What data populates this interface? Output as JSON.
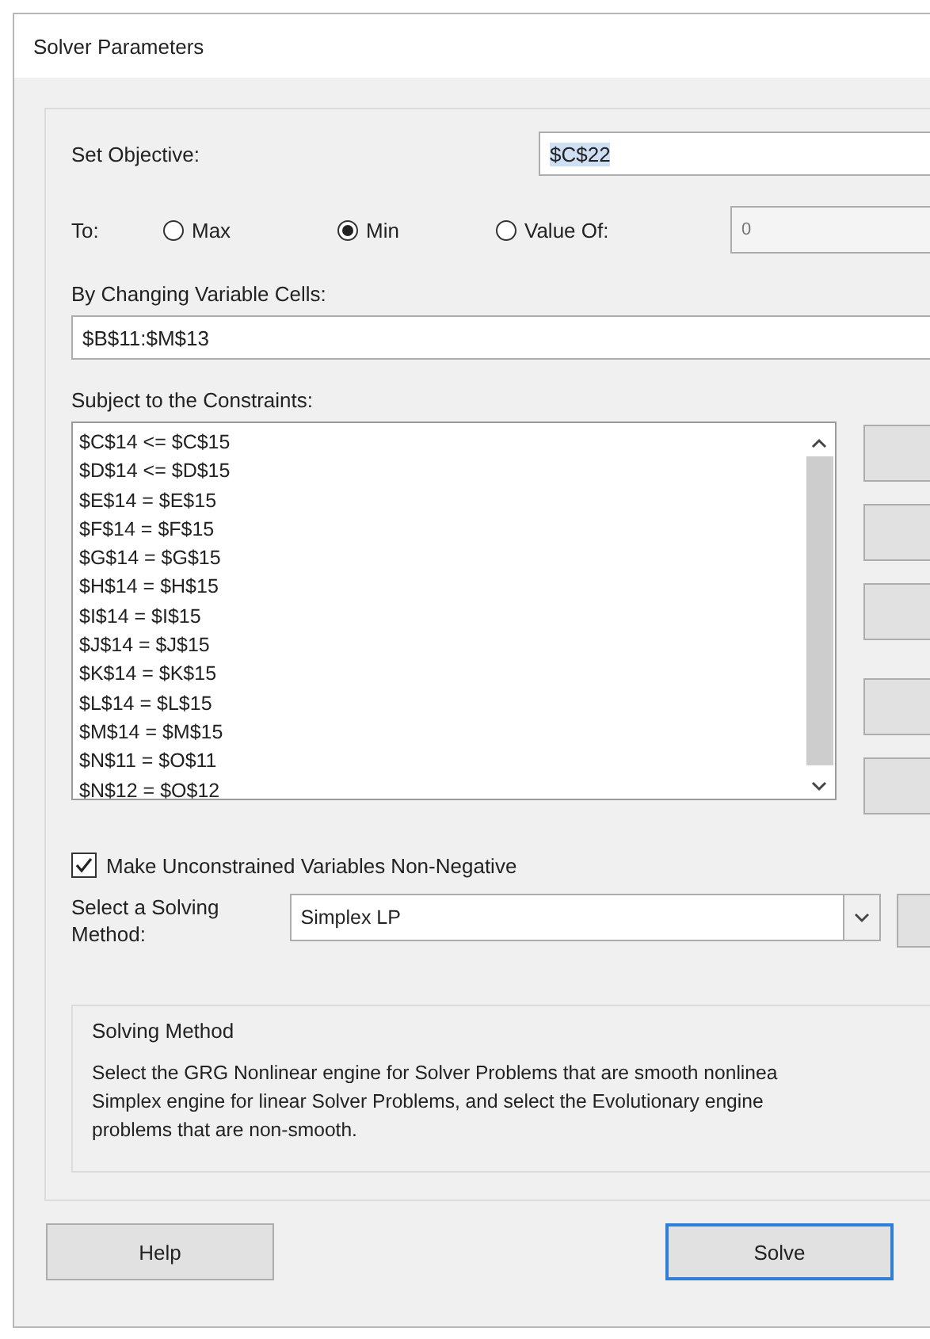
{
  "window": {
    "title": "Solver Parameters"
  },
  "objective": {
    "label": "Set Objective:",
    "value": "$C$22"
  },
  "to": {
    "label": "To:",
    "options": [
      {
        "label": "Max",
        "selected": false
      },
      {
        "label": "Min",
        "selected": true
      },
      {
        "label": "Value Of:",
        "selected": false
      }
    ],
    "value": "0"
  },
  "variable_cells": {
    "label": "By Changing Variable Cells:",
    "value": "$B$11:$M$13"
  },
  "constraints": {
    "label": "Subject to the Constraints:",
    "items": [
      "$C$14 <= $C$15",
      "$D$14 <= $D$15",
      "$E$14 = $E$15",
      "$F$14 = $F$15",
      "$G$14 = $G$15",
      "$H$14 = $H$15",
      "$I$14 = $I$15",
      "$J$14 = $J$15",
      "$K$14 = $K$15",
      "$L$14 = $L$15",
      "$M$14 = $M$15",
      "$N$11 = $O$11",
      "$N$12 = $O$12"
    ],
    "side_buttons": [
      {
        "kind": "button"
      },
      {
        "kind": "button"
      },
      {
        "kind": "button"
      },
      {
        "kind": "gap"
      },
      {
        "kind": "button"
      },
      {
        "kind": "button"
      }
    ]
  },
  "non_negative": {
    "label": "Make Unconstrained Variables Non-Negative",
    "checked": true
  },
  "solving_method": {
    "label": "Select a Solving Method:",
    "value": "Simplex LP"
  },
  "method_group": {
    "title": "Solving Method",
    "text": "Select the GRG Nonlinear engine for Solver Problems that are smooth nonlinea\nSimplex engine for linear Solver Problems, and select the Evolutionary engine\nproblems that are non-smooth."
  },
  "buttons": [
    {
      "label": "Help",
      "selected": false
    },
    {
      "label": "Solve",
      "selected": true
    }
  ]
}
